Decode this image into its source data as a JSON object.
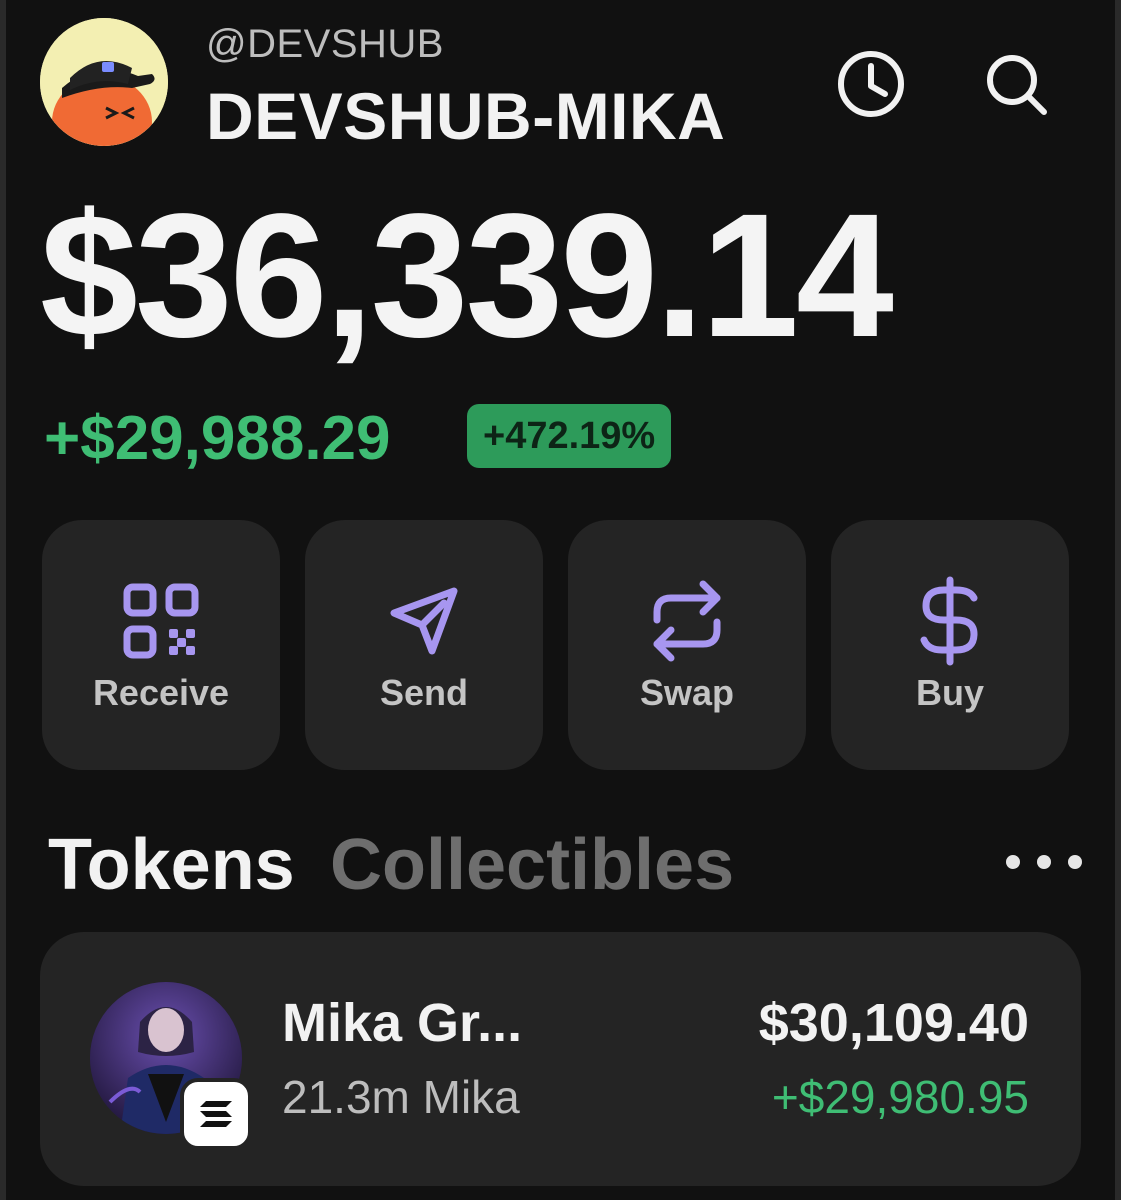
{
  "header": {
    "handle": "@DEVSHUB",
    "account_name": "DEVSHUB-MIKA",
    "avatar_icon": "avatar-orange-blob-cap",
    "history_icon": "clock-icon",
    "search_icon": "search-icon"
  },
  "balance": {
    "total": "$36,339.14",
    "change": "+$29,988.29",
    "change_percent": "+472.19%"
  },
  "actions": [
    {
      "label": "Receive",
      "icon": "qr-code-icon"
    },
    {
      "label": "Send",
      "icon": "send-icon"
    },
    {
      "label": "Swap",
      "icon": "swap-icon"
    },
    {
      "label": "Buy",
      "icon": "dollar-icon"
    }
  ],
  "tabs": [
    {
      "label": "Tokens",
      "active": true
    },
    {
      "label": "Collectibles",
      "active": false
    }
  ],
  "tokens": [
    {
      "name": "Mika Gr...",
      "amount": "21.3m Mika",
      "value": "$30,109.40",
      "pnl": "+$29,980.95",
      "chain_icon": "solana-icon"
    }
  ],
  "colors": {
    "background": "#111111",
    "card": "#242424",
    "positive": "#3fbd74",
    "badge": "#2d9b5a",
    "accent_icon": "#a796f0"
  }
}
